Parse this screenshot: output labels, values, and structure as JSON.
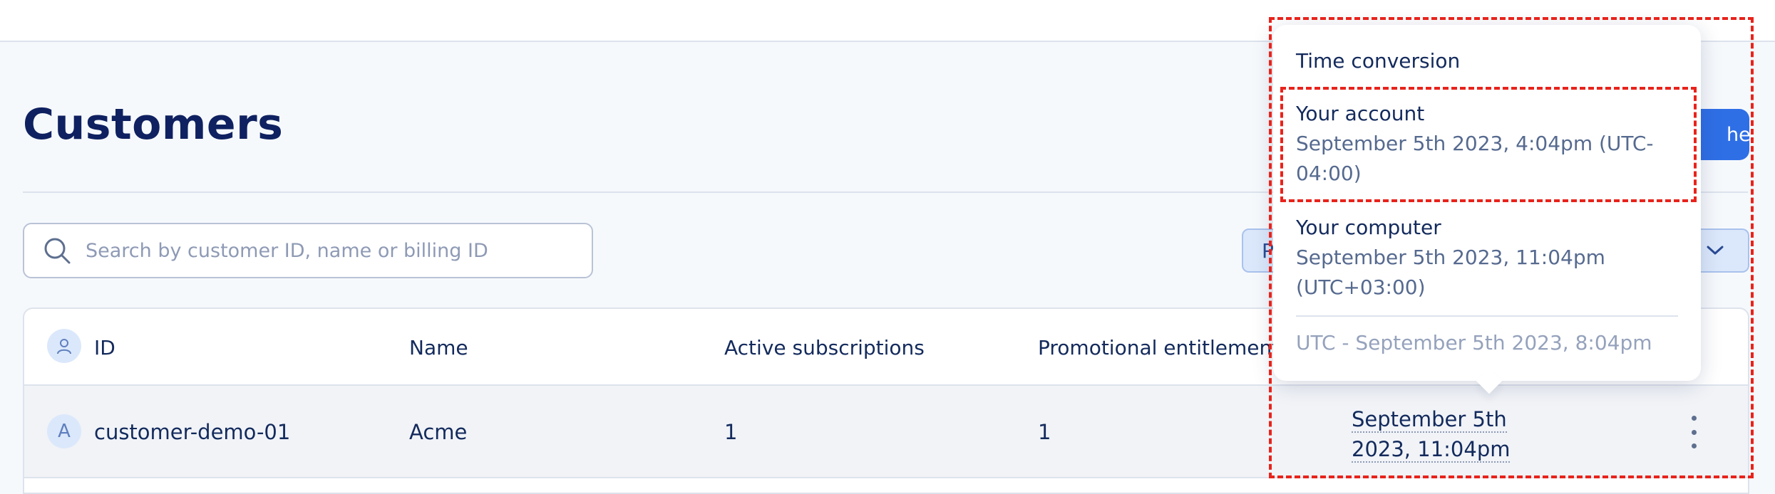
{
  "page": {
    "title": "Customers",
    "primary_button_label": "her"
  },
  "search": {
    "placeholder": "Search by customer ID, name or billing ID",
    "value": ""
  },
  "filter": {
    "chip_label": "P"
  },
  "table": {
    "columns": [
      "ID",
      "Name",
      "Active subscriptions",
      "Promotional entitlement"
    ],
    "rows": [
      {
        "avatar_letter": "A",
        "id": "customer-demo-01",
        "name": "Acme",
        "active_subscriptions": "1",
        "promotional_entitlements": "1",
        "date": "September 5th 2023, 11:04pm"
      }
    ]
  },
  "time_conversion": {
    "title": "Time conversion",
    "account_label": "Your account",
    "account_value": "September 5th 2023, 4:04pm (UTC-04:00)",
    "computer_label": "Your computer",
    "computer_value": "September 5th 2023, 11:04pm (UTC+03:00)",
    "utc_value": "UTC - September 5th 2023, 8:04pm"
  },
  "colors": {
    "accent": "#2f6fe6",
    "highlight": "#e8231b",
    "text": "#132a5c"
  },
  "icons": {
    "search": "search-icon",
    "person": "person-icon",
    "chevron": "chevron-down-icon",
    "more": "more-vertical-icon"
  }
}
